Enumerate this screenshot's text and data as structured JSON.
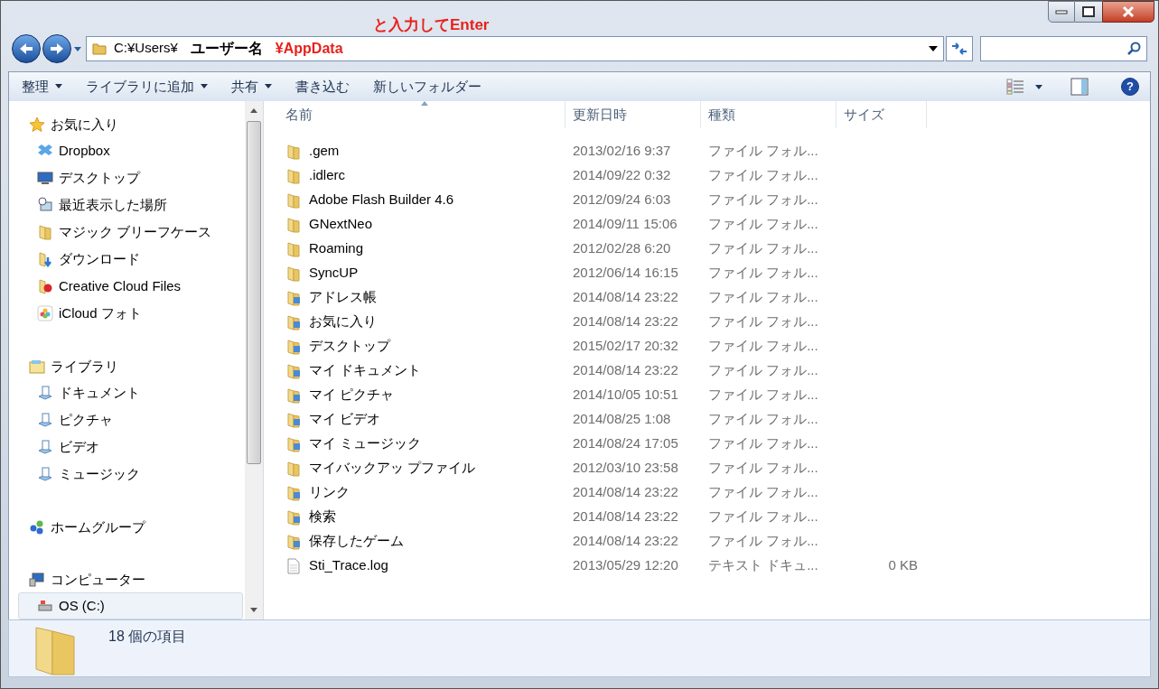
{
  "annotation": "と入力してEnter",
  "address": {
    "segments": [
      {
        "text": "C:¥Users¥",
        "kind": "plain"
      },
      {
        "text": "ユーザー名",
        "kind": "bold"
      },
      {
        "text": "¥AppData",
        "kind": "highlight"
      }
    ]
  },
  "toolbar": {
    "items": [
      {
        "label": "整理",
        "dropdown": true
      },
      {
        "label": "ライブラリに追加",
        "dropdown": true
      },
      {
        "label": "共有",
        "dropdown": true
      },
      {
        "label": "書き込む",
        "dropdown": false
      },
      {
        "label": "新しいフォルダー",
        "dropdown": false
      }
    ]
  },
  "sidebar": {
    "groups": [
      {
        "label": "お気に入り",
        "kind": "star",
        "children": [
          {
            "label": "Dropbox",
            "kind": "dropbox",
            "selected": false
          },
          {
            "label": "デスクトップ",
            "kind": "desktop",
            "selected": false
          },
          {
            "label": "最近表示した場所",
            "kind": "recent",
            "selected": false
          },
          {
            "label": "マジック ブリーフケース",
            "kind": "folder",
            "selected": false
          },
          {
            "label": "ダウンロード",
            "kind": "download",
            "selected": false
          },
          {
            "label": "Creative Cloud Files",
            "kind": "cloud",
            "selected": false
          },
          {
            "label": "iCloud フォト",
            "kind": "photos",
            "selected": false
          }
        ]
      },
      {
        "label": "ライブラリ",
        "kind": "library",
        "children": [
          {
            "label": "ドキュメント",
            "kind": "library-item",
            "selected": false
          },
          {
            "label": "ピクチャ",
            "kind": "library-item",
            "selected": false
          },
          {
            "label": "ビデオ",
            "kind": "library-item",
            "selected": false
          },
          {
            "label": "ミュージック",
            "kind": "library-item",
            "selected": false
          }
        ]
      },
      {
        "label": "ホームグループ",
        "kind": "homegroup"
      },
      {
        "label": "コンピューター",
        "kind": "computer",
        "children": [
          {
            "label": "OS (C:)",
            "kind": "drive",
            "selected": true
          }
        ]
      }
    ]
  },
  "table": {
    "columns": [
      "名前",
      "更新日時",
      "種類",
      "サイズ"
    ],
    "rows": [
      {
        "name": ".gem",
        "date": "2013/02/16 9:37",
        "type": "ファイル フォル...",
        "kind": "folder"
      },
      {
        "name": ".idlerc",
        "date": "2014/09/22 0:32",
        "type": "ファイル フォル...",
        "kind": "folder"
      },
      {
        "name": "Adobe Flash Builder 4.6",
        "date": "2012/09/24 6:03",
        "type": "ファイル フォル...",
        "kind": "folder"
      },
      {
        "name": "GNextNeo",
        "date": "2014/09/11 15:06",
        "type": "ファイル フォル...",
        "kind": "folder"
      },
      {
        "name": "Roaming",
        "date": "2012/02/28 6:20",
        "type": "ファイル フォル...",
        "kind": "folder"
      },
      {
        "name": "SyncUP",
        "date": "2012/06/14 16:15",
        "type": "ファイル フォル...",
        "kind": "folder"
      },
      {
        "name": "アドレス帳",
        "date": "2014/08/14 23:22",
        "type": "ファイル フォル...",
        "kind": "special-folder"
      },
      {
        "name": "お気に入り",
        "date": "2014/08/14 23:22",
        "type": "ファイル フォル...",
        "kind": "special-folder"
      },
      {
        "name": "デスクトップ",
        "date": "2015/02/17 20:32",
        "type": "ファイル フォル...",
        "kind": "special-folder"
      },
      {
        "name": "マイ ドキュメント",
        "date": "2014/08/14 23:22",
        "type": "ファイル フォル...",
        "kind": "special-folder"
      },
      {
        "name": "マイ ピクチャ",
        "date": "2014/10/05 10:51",
        "type": "ファイル フォル...",
        "kind": "special-folder"
      },
      {
        "name": "マイ ビデオ",
        "date": "2014/08/25 1:08",
        "type": "ファイル フォル...",
        "kind": "special-folder"
      },
      {
        "name": "マイ ミュージック",
        "date": "2014/08/24 17:05",
        "type": "ファイル フォル...",
        "kind": "special-folder"
      },
      {
        "name": "マイバックアッ プファイル",
        "date": "2012/03/10 23:58",
        "type": "ファイル フォル...",
        "kind": "folder"
      },
      {
        "name": "リンク",
        "date": "2014/08/14 23:22",
        "type": "ファイル フォル...",
        "kind": "special-folder"
      },
      {
        "name": "検索",
        "date": "2014/08/14 23:22",
        "type": "ファイル フォル...",
        "kind": "special-folder"
      },
      {
        "name": "保存したゲーム",
        "date": "2014/08/14 23:22",
        "type": "ファイル フォル...",
        "kind": "special-folder"
      },
      {
        "name": "Sti_Trace.log",
        "date": "2013/05/29 12:20",
        "type": "テキスト ドキュ...",
        "size": "0 KB",
        "kind": "file"
      }
    ]
  },
  "help_button": "?",
  "status_bar": {
    "count": "18 個の項目"
  }
}
